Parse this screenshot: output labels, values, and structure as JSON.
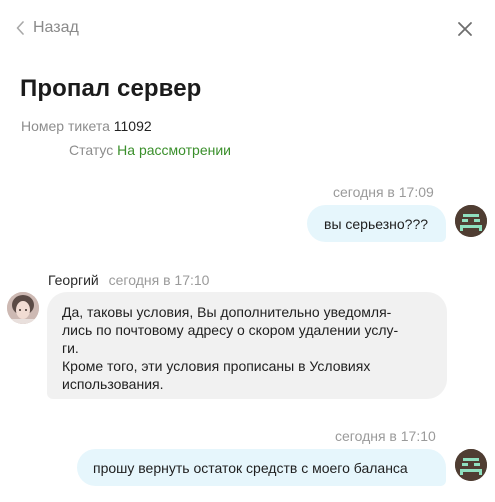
{
  "header": {
    "back_label": "Назад",
    "back_icon": "chevron-left-icon",
    "close_icon": "close-icon"
  },
  "ticket": {
    "title": "Пропал сервер",
    "number_label": "Номер тикета",
    "number_value": "11092",
    "status_label": "Статус",
    "status_value": "На рассмотрении",
    "status_color": "#3a8f2b"
  },
  "messages": [
    {
      "author": "me",
      "time": "сегодня в 17:09",
      "text": "вы серьезно???",
      "bubble_color": "#e6f6fc"
    },
    {
      "author": "Георгий",
      "time": "сегодня в 17:10",
      "lines": [
        "Да, таковы условия, Вы дополнительно уведомля-",
        "лись по почтовому адресу о скором удалении услу-",
        "ги.",
        "Кроме того, эти условия прописаны в Условиях",
        "использования."
      ],
      "bubble_color": "#f1f1f1"
    },
    {
      "author": "me",
      "time": "сегодня в 17:10",
      "text": "прошу вернуть остаток средств с моего баланса",
      "bubble_color": "#e6f6fc"
    }
  ]
}
